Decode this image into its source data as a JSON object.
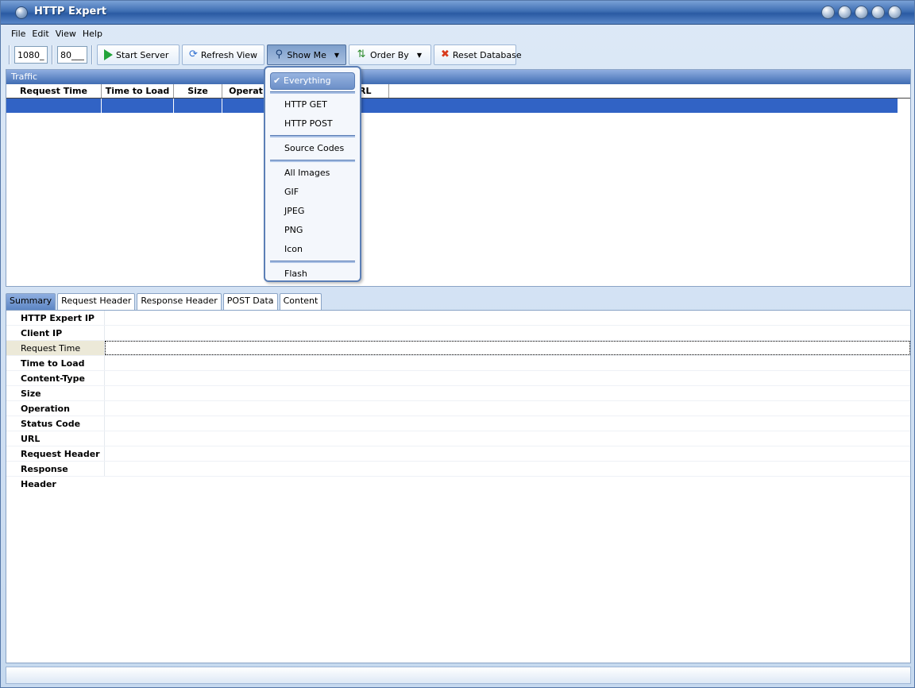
{
  "window": {
    "title": "HTTP Expert"
  },
  "menu": [
    "File",
    "Edit",
    "View",
    "Help"
  ],
  "toolbar": {
    "ip_value": "1080_",
    "port_value": "80___",
    "start_server": "Start Server",
    "refresh_view": "Refresh View",
    "show_me": "Show Me",
    "order_by": "Order By",
    "reset_database": "Reset Database"
  },
  "traffic": {
    "title": "Traffic",
    "columns": [
      "Request Time",
      "Time to Load",
      "Size",
      "Operat",
      "",
      "RL"
    ]
  },
  "show_me_menu": {
    "everything": "Everything",
    "http_get": "HTTP GET",
    "http_post": "HTTP POST",
    "source_codes": "Source Codes",
    "all_images": "All Images",
    "gif": "GIF",
    "jpeg": "JPEG",
    "png": "PNG",
    "icon": "Icon",
    "flash": "Flash"
  },
  "tabs": [
    "Summary",
    "Request Header",
    "Response Header",
    "POST Data",
    "Content"
  ],
  "summary_fields": [
    "HTTP Expert IP",
    "Client IP",
    "Request Time",
    "Time to Load",
    "Content-Type",
    "Size",
    "Operation",
    "Status Code",
    "URL",
    "Request Header",
    "Response Header"
  ]
}
